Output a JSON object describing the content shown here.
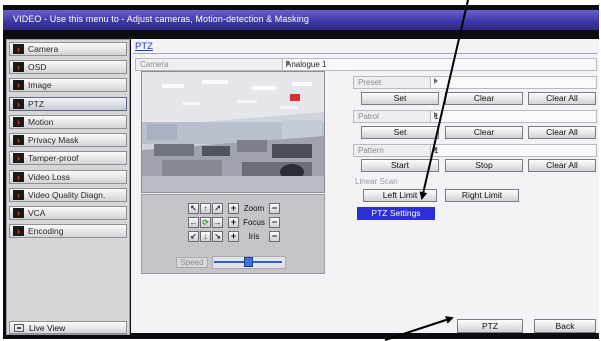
{
  "window": {
    "title": "VIDEO - Use this menu to - Adjust cameras, Motion-detection & Masking"
  },
  "sidebar": {
    "items": [
      {
        "label": "Camera"
      },
      {
        "label": "OSD"
      },
      {
        "label": "Image"
      },
      {
        "label": "PTZ"
      },
      {
        "label": "Motion"
      },
      {
        "label": "Privacy Mask"
      },
      {
        "label": "Tamper-proof"
      },
      {
        "label": "Video Loss"
      },
      {
        "label": "Video Quality Diagn."
      },
      {
        "label": "VCA"
      },
      {
        "label": "Encoding"
      }
    ],
    "active_item": "PTZ",
    "live_view_label": "Live View"
  },
  "pane": {
    "title": "PTZ",
    "camera_label": "Camera",
    "camera_value": "Analogue 1"
  },
  "ptz_controls": {
    "zoom_label": "Zoom",
    "focus_label": "Focus",
    "iris_label": "Iris",
    "speed_label": "Speed",
    "speed_level": 0.5
  },
  "preset": {
    "label": "Preset",
    "value": "",
    "set_label": "Set",
    "clear_label": "Clear",
    "clear_all_label": "Clear All"
  },
  "patrol": {
    "label": "Patrol",
    "value": "1",
    "set_label": "Set",
    "clear_label": "Clear",
    "clear_all_label": "Clear All"
  },
  "pattern": {
    "label": "Pattern",
    "value": "1",
    "start_label": "Start",
    "stop_label": "Stop",
    "clear_all_label": "Clear All"
  },
  "linear_scan": {
    "label": "Linear Scan",
    "left_limit_label": "Left Limit",
    "right_limit_label": "Right Limit"
  },
  "ptz_settings_label": "PTZ Settings",
  "footer": {
    "ptz_button_label": "PTZ",
    "back_button_label": "Back"
  },
  "colors": {
    "title_bar": "#3e36a6",
    "selected_button": "#2b2fd6",
    "link_blue": "#2a35c8",
    "sidebar_chevron": "#ff4a2a"
  }
}
